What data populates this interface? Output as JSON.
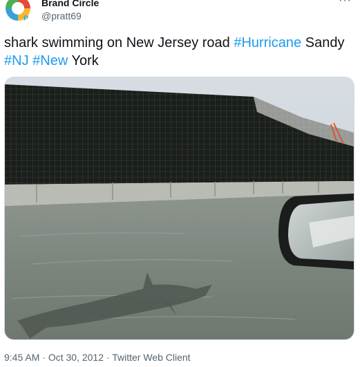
{
  "author": {
    "name": "Brand Circle",
    "handle": "@pratt69",
    "avatar_icon": "brand-circle-logo-icon"
  },
  "menu_icon": "more-dots-icon",
  "tweet": {
    "segments": [
      {
        "text": "shark swimming on New Jersey road ",
        "hashtag": false
      },
      {
        "text": "#Hurricane",
        "hashtag": true
      },
      {
        "text": " Sandy ",
        "hashtag": false
      },
      {
        "text": "#NJ",
        "hashtag": true
      },
      {
        "text": " ",
        "hashtag": false
      },
      {
        "text": "#New",
        "hashtag": true
      },
      {
        "text": " York",
        "hashtag": false
      }
    ]
  },
  "meta": {
    "time": "9:45 AM",
    "separator": "·",
    "date": "Oct 30, 2012",
    "source": "Twitter Web Client"
  },
  "colors": {
    "hashtag": "#1d9bf0",
    "secondary_text": "#536471",
    "primary_text": "#0f1419"
  }
}
